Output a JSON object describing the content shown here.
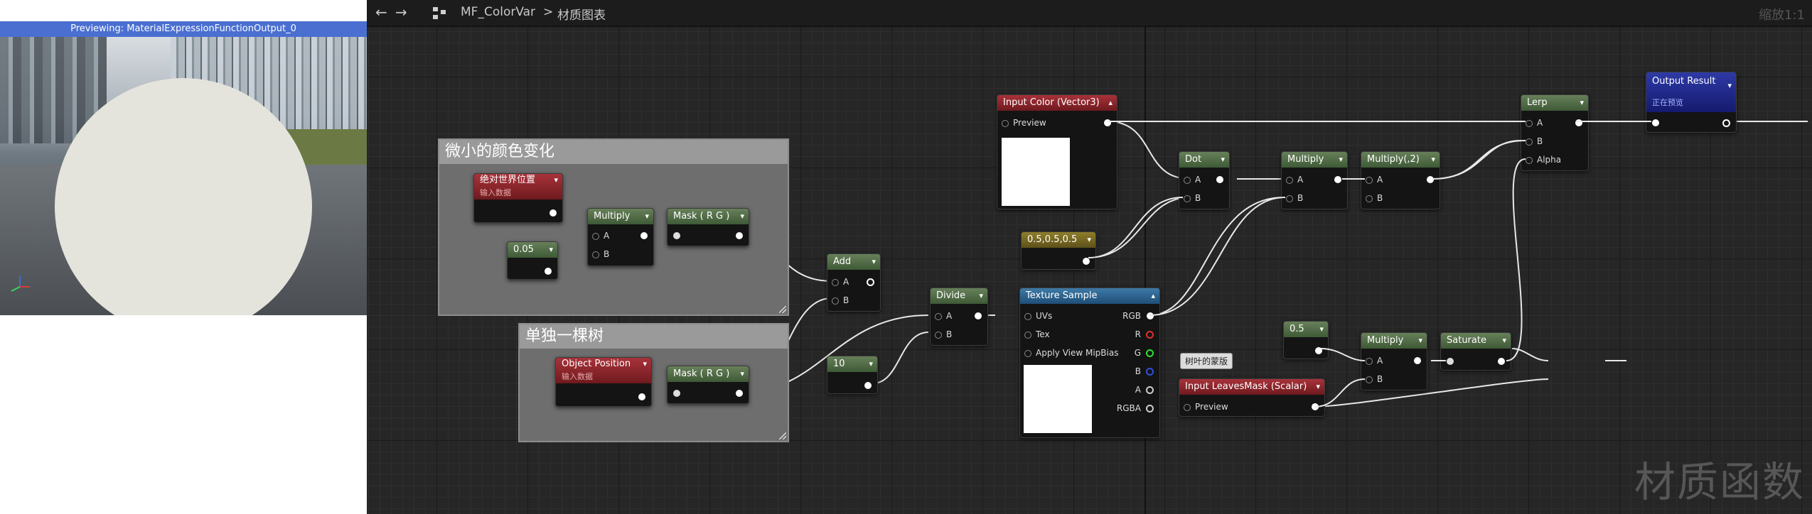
{
  "preview": {
    "title": "Previewing: MaterialExpressionFunctionOutput_0"
  },
  "toolbar": {
    "back": "←",
    "forward": "→",
    "asset": "MF_ColorVar",
    "separator": ">",
    "graph": "材质图表",
    "zoom": "缩放1:1"
  },
  "watermark": "材质函数",
  "comments": [
    {
      "title": "微小的颜色变化"
    },
    {
      "title": "单独一棵树"
    }
  ],
  "nodes": {
    "abs_world_pos": {
      "title": "绝对世界位置",
      "subtitle": "输入数据"
    },
    "const_005": {
      "title": "0.05"
    },
    "multiply1": {
      "title": "Multiply",
      "pin_a": "A",
      "pin_b": "B"
    },
    "mask1": {
      "title": "Mask ( R G )"
    },
    "object_position": {
      "title": "Object Position",
      "subtitle": "输入数据"
    },
    "mask2": {
      "title": "Mask ( R G )"
    },
    "add": {
      "title": "Add",
      "pin_a": "A",
      "pin_b": "B"
    },
    "const_10": {
      "title": "10"
    },
    "divide": {
      "title": "Divide",
      "pin_a": "A",
      "pin_b": "B"
    },
    "input_color": {
      "title": "Input Color (Vector3)",
      "preview": "Preview"
    },
    "const_vec": {
      "title": "0.5,0.5,0.5"
    },
    "texture_sample": {
      "title": "Texture Sample",
      "uvs": "UVs",
      "tex": "Tex",
      "mipbias": "Apply View MipBias",
      "rgb": "RGB",
      "r": "R",
      "g": "G",
      "b": "B",
      "a": "A",
      "rgba": "RGBA"
    },
    "dot": {
      "title": "Dot",
      "pin_a": "A",
      "pin_b": "B"
    },
    "multiply2": {
      "title": "Multiply",
      "pin_a": "A",
      "pin_b": "B"
    },
    "multiply3": {
      "title": "Multiply(,2)",
      "pin_a": "A",
      "pin_b": "B"
    },
    "lerp": {
      "title": "Lerp",
      "pin_a": "A",
      "pin_b": "B",
      "alpha": "Alpha"
    },
    "output": {
      "title": "Output Result",
      "subtitle": "正在预览"
    },
    "const_05": {
      "title": "0.5"
    },
    "leaves_tag": {
      "title": "树叶的蒙版"
    },
    "input_leaves": {
      "title": "Input LeavesMask (Scalar)",
      "preview": "Preview"
    },
    "multiply4": {
      "title": "Multiply",
      "pin_a": "A",
      "pin_b": "B"
    },
    "saturate": {
      "title": "Saturate"
    }
  },
  "colors": {
    "header_green": "#4f6a45",
    "header_red": "#8e262c",
    "header_blue": "#2c6490",
    "header_olive": "#766622",
    "header_navy": "#1e2a8a",
    "preview_bar": "#4a6fd1",
    "grid_bg": "#262626"
  },
  "icons": [
    "arrow-left-icon",
    "arrow-right-icon",
    "graph-icon",
    "axis-gizmo-icon"
  ]
}
